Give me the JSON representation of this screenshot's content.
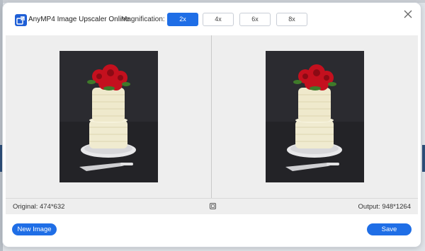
{
  "app": {
    "title": "AnyMP4 Image Upscaler Online"
  },
  "magnification": {
    "label": "Magnification:",
    "options": [
      "2x",
      "4x",
      "6x",
      "8x"
    ],
    "selected": "2x"
  },
  "info": {
    "original": "Original: 474*632",
    "output": "Output: 948*1264"
  },
  "footer": {
    "new_image_label": "New Image",
    "save_label": "Save"
  },
  "icons": {
    "logo": "anymp4-logo-icon",
    "close": "close-icon",
    "compare": "compare-icon"
  },
  "colors": {
    "accent": "#1f6ee6",
    "preview_bg": "#eeeeee",
    "rose": "#c4101e",
    "frosting": "#f0ebd0"
  }
}
